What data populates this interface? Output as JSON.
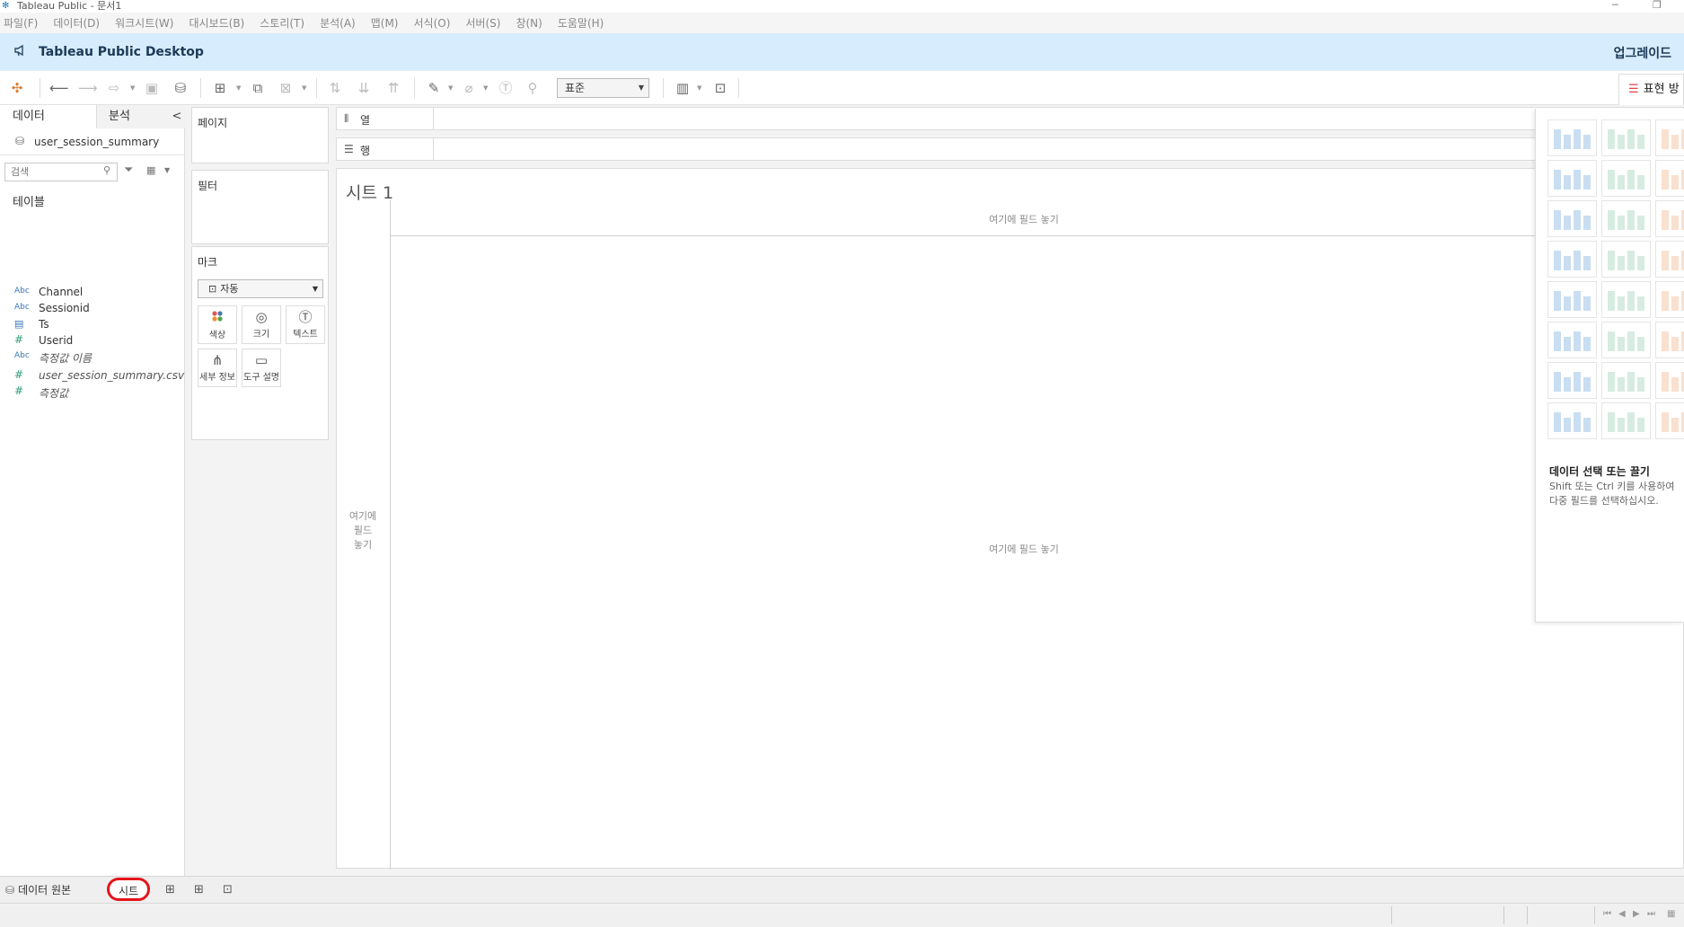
{
  "window": {
    "title": "Tableau Public - 문서1",
    "minimize": "─",
    "restore": "❐"
  },
  "menu": [
    "파일(F)",
    "데이터(D)",
    "워크시트(W)",
    "대시보드(B)",
    "스토리(T)",
    "분석(A)",
    "맵(M)",
    "서식(O)",
    "서버(S)",
    "창(N)",
    "도움말(H)"
  ],
  "banner": {
    "product": "Tableau Public Desktop",
    "upgrade": "업그레이드"
  },
  "toolbar": {
    "fit_value": "표준",
    "show_me_label": "표현 방식"
  },
  "data_pane": {
    "tab_data": "데이터",
    "tab_analysis": "분석",
    "collapse": "<",
    "datasource": "user_session_summary",
    "search_placeholder": "검색",
    "tables_heading": "테이블",
    "fields": [
      {
        "type": "Abc",
        "name": "Channel",
        "italic": false
      },
      {
        "type": "Abc",
        "name": "Sessionid",
        "italic": false
      },
      {
        "type": "date",
        "name": "Ts",
        "italic": false
      },
      {
        "type": "#",
        "name": "Userid",
        "italic": false
      },
      {
        "type": "Abc",
        "name": "측정값 이름",
        "italic": true
      },
      {
        "type": "#",
        "name": "user_session_summary.csv(...",
        "italic": true
      },
      {
        "type": "#",
        "name": "측정값",
        "italic": true
      }
    ]
  },
  "cards": {
    "pages": "페이지",
    "filters": "필터",
    "marks": "마크",
    "marks_type": "자동",
    "mark_buttons": [
      "색상",
      "크기",
      "텍스트",
      "세부 정보",
      "도구 설명"
    ]
  },
  "shelves": {
    "columns": "열",
    "rows": "행"
  },
  "view": {
    "sheet_title": "시트 1",
    "col_drop": "여기에 필드 놓기",
    "row_drop_l1": "여기에",
    "row_drop_l2": "필드",
    "row_drop_l3": "놓기",
    "center_drop": "여기에 필드 놓기"
  },
  "show_me": {
    "hint_title": "데이터 선택 또는 끌기",
    "hint_line1": "Shift 또는 Ctrl 키를 사용하여",
    "hint_line2": "다중 필드를 선택하십시오."
  },
  "bottom": {
    "datasource_tab": "데이터 원본",
    "sheet_tab": "시트"
  },
  "colors": {
    "banner_bg": "#d7ecfc",
    "annotation_red": "#e4141b",
    "number_field": "#2e9d7b",
    "dimension_field": "#3a78b5"
  }
}
